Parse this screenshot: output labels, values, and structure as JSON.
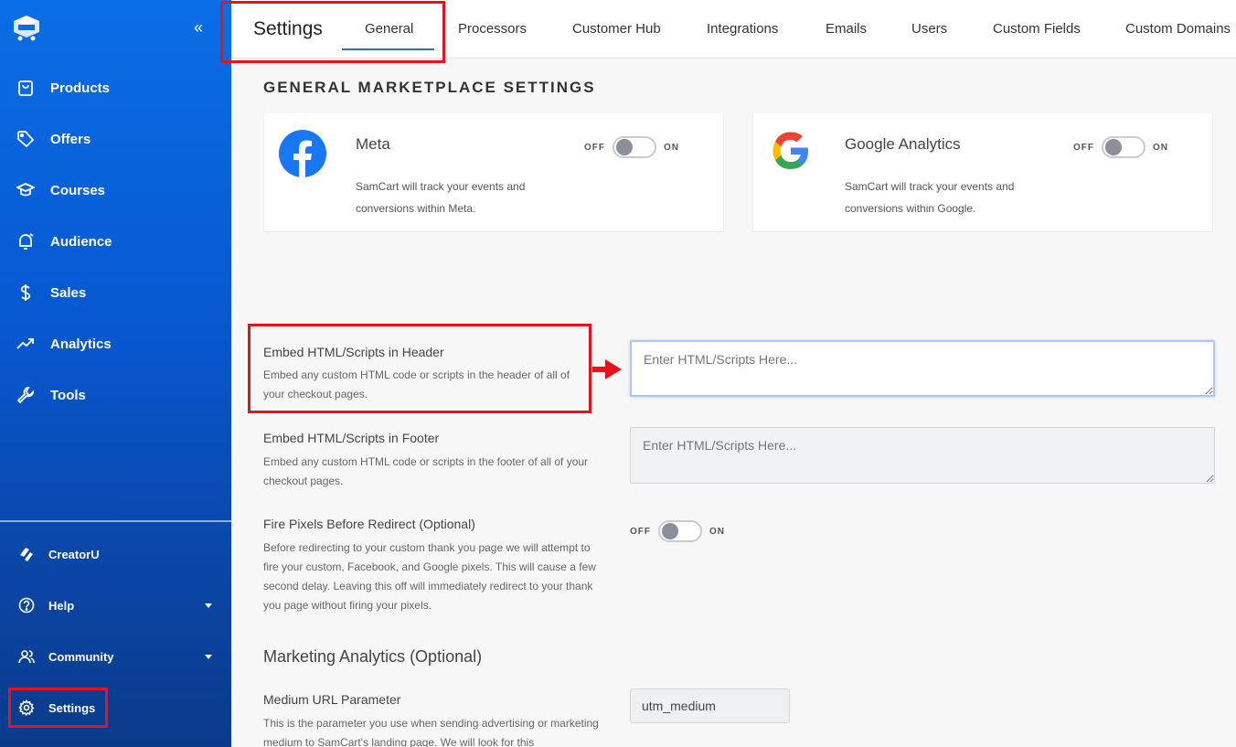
{
  "sidebar": {
    "collapse_glyph": "«",
    "items": [
      {
        "label": "Products",
        "icon": "shopping-bag-icon"
      },
      {
        "label": "Offers",
        "icon": "tag-icon"
      },
      {
        "label": "Courses",
        "icon": "graduation-cap-icon"
      },
      {
        "label": "Audience",
        "icon": "bell-icon"
      },
      {
        "label": "Sales",
        "icon": "dollar-icon"
      },
      {
        "label": "Analytics",
        "icon": "trending-up-icon"
      },
      {
        "label": "Tools",
        "icon": "wrench-icon"
      }
    ],
    "bottom_items": [
      {
        "label": "CreatorU",
        "icon": "creatoru-icon"
      },
      {
        "label": "Help",
        "icon": "help-icon"
      },
      {
        "label": "Community",
        "icon": "users-icon"
      },
      {
        "label": "Settings",
        "icon": "gear-icon"
      }
    ]
  },
  "topbar": {
    "title": "Settings",
    "tabs": [
      "General",
      "Processors",
      "Customer Hub",
      "Integrations",
      "Emails",
      "Users",
      "Custom Fields",
      "Custom Domains"
    ],
    "active_tab": "General"
  },
  "main": {
    "section_title": "GENERAL MARKETPLACE SETTINGS",
    "cards": [
      {
        "name": "Meta",
        "description": "SamCart will track your events and conversions within Meta.",
        "off": "OFF",
        "on": "ON",
        "state": "off"
      },
      {
        "name": "Google Analytics",
        "description": "SamCart will track your events and conversions within Google.",
        "off": "OFF",
        "on": "ON",
        "state": "off"
      }
    ],
    "header_scripts": {
      "label": "Embed HTML/Scripts in Header",
      "description": "Embed any custom HTML code or scripts in the header of all of your checkout pages.",
      "placeholder": "Enter HTML/Scripts Here..."
    },
    "footer_scripts": {
      "label": "Embed HTML/Scripts in Footer",
      "description": "Embed any custom HTML code or scripts in the footer of all of your checkout pages.",
      "placeholder": "Enter HTML/Scripts Here..."
    },
    "fire_pixels": {
      "label": "Fire Pixels Before Redirect (Optional)",
      "description": "Before redirecting to your custom thank you page we will attempt to fire your custom, Facebook, and Google pixels. This will cause a few second delay. Leaving this off will immediately redirect to your thank you page without firing your pixels.",
      "off": "OFF",
      "on": "ON",
      "state": "off"
    },
    "marketing_heading": "Marketing Analytics (Optional)",
    "medium": {
      "label": "Medium URL Parameter",
      "description": "This is the parameter you use when sending advertising or marketing medium to SamCart's landing page. We will look for this",
      "value": "utm_medium"
    }
  },
  "colors": {
    "accent": "#0a6ee6",
    "highlight": "#e3141a",
    "tab_underline": "#3a6ea5"
  }
}
